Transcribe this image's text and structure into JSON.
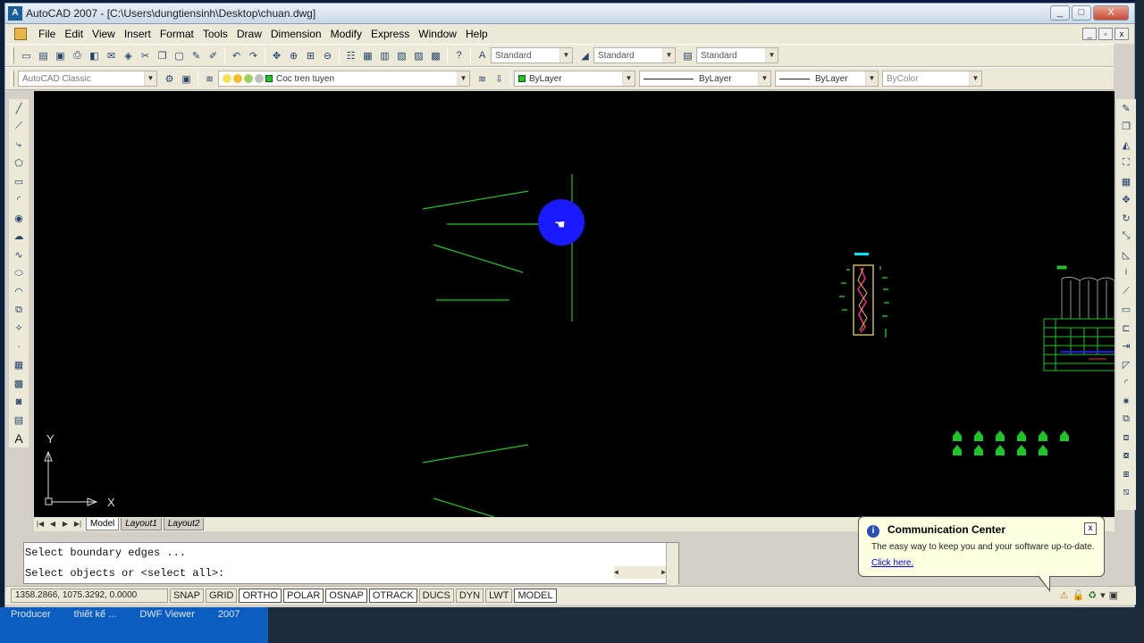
{
  "window": {
    "title": "AutoCAD 2007 - [C:\\Users\\dungtiensinh\\Desktop\\chuan.dwg]",
    "min": "_",
    "max": "□",
    "close": "X"
  },
  "menu": [
    "File",
    "Edit",
    "View",
    "Insert",
    "Format",
    "Tools",
    "Draw",
    "Dimension",
    "Modify",
    "Express",
    "Window",
    "Help"
  ],
  "toolbar1": {
    "text_style": "Standard",
    "dim_style": "Standard",
    "table_style": "Standard"
  },
  "toolbar2": {
    "workspace": "AutoCAD Classic",
    "layer": "Coc tren tuyen",
    "color": "ByLayer",
    "linetype": "ByLayer",
    "lineweight": "ByLayer",
    "plotstyle": "ByColor"
  },
  "ucs": {
    "x": "X",
    "y": "Y"
  },
  "tabs": [
    "Model",
    "Layout1",
    "Layout2"
  ],
  "command": {
    "line1": "Select boundary edges ...",
    "line2": "Select objects or <select all>:"
  },
  "status": {
    "coords": "1358.2866, 1075.3292, 0.0000",
    "buttons": [
      "SNAP",
      "GRID",
      "ORTHO",
      "POLAR",
      "OSNAP",
      "OTRACK",
      "DUCS",
      "DYN",
      "LWT",
      "MODEL"
    ]
  },
  "balloon": {
    "title": "Communication Center",
    "text": "The easy way to keep you and your software up-to-date.",
    "link": "Click here."
  },
  "taskbar": [
    "Producer",
    "thiết kế ...",
    "DWF Viewer",
    "2007"
  ],
  "colors": {
    "canvas": "#000000",
    "geometry": "#22c22a",
    "cursor": "#1a1aff",
    "accent": "#00e5ff"
  }
}
